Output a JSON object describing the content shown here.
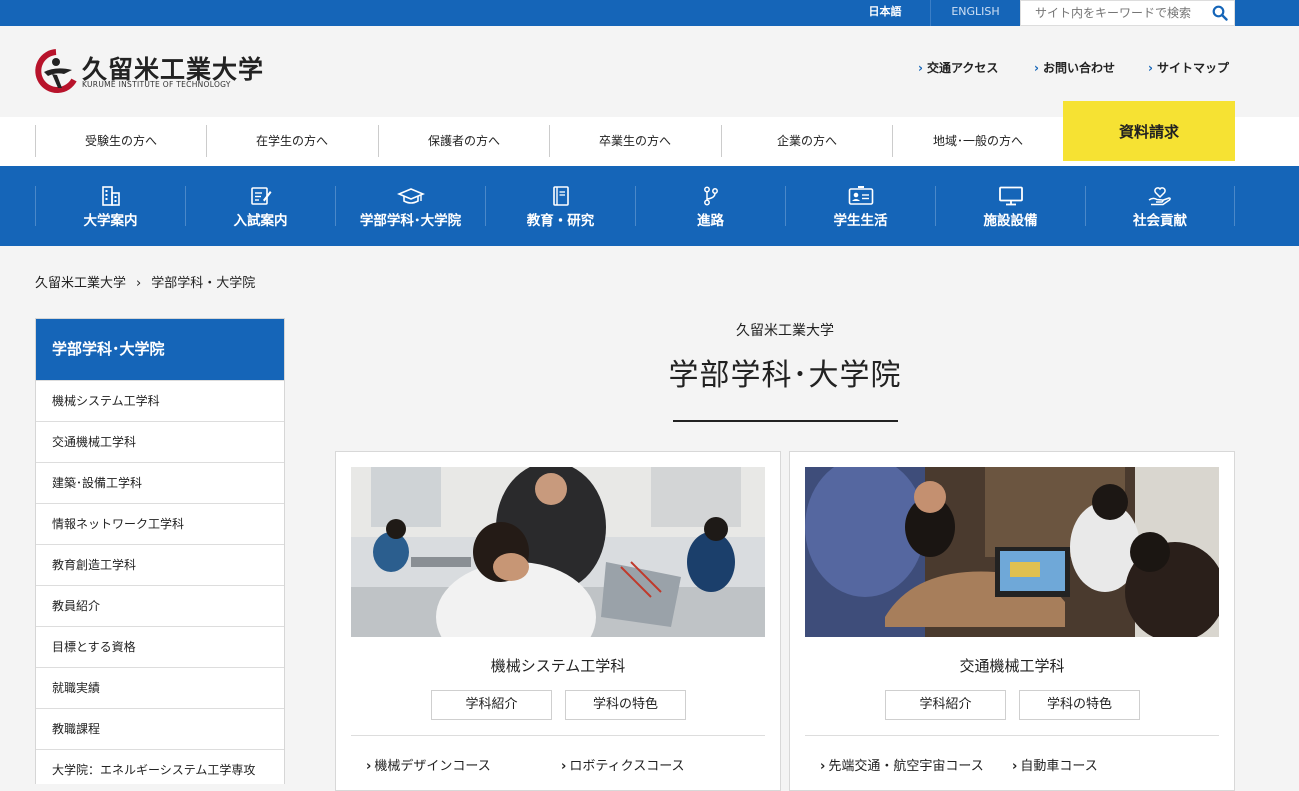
{
  "topbar": {
    "lang_ja": "日本語",
    "lang_en": "ENGLISH",
    "search_placeholder": "サイト内をキーワードで検索",
    "search_icon": "search-icon"
  },
  "header": {
    "logo_name": "久留米工業大学",
    "logo_sub": "KURUME INSTITUTE OF TECHNOLOGY",
    "util_links": [
      "交通アクセス",
      "お問い合わせ",
      "サイトマップ"
    ]
  },
  "audience": {
    "items": [
      "受験生の方へ",
      "在学生の方へ",
      "保護者の方へ",
      "卒業生の方へ",
      "企業の方へ",
      "地域･一般の方へ"
    ],
    "request_label": "資料請求"
  },
  "gnav": {
    "items": [
      {
        "label": "大学案内",
        "icon": "building-icon"
      },
      {
        "label": "入試案内",
        "icon": "document-pen-icon"
      },
      {
        "label": "学部学科･大学院",
        "icon": "mortarboard-icon"
      },
      {
        "label": "教育・研究",
        "icon": "book-icon"
      },
      {
        "label": "進路",
        "icon": "branch-icon"
      },
      {
        "label": "学生生活",
        "icon": "id-card-icon"
      },
      {
        "label": "施設設備",
        "icon": "monitor-icon"
      },
      {
        "label": "社会貢献",
        "icon": "hand-heart-icon"
      }
    ]
  },
  "breadcrumb": {
    "home": "久留米工業大学",
    "separator": "›",
    "current": "学部学科・大学院"
  },
  "sidebar": {
    "title": "学部学科･大学院",
    "items": [
      "機械システム工学科",
      "交通機械工学科",
      "建築･設備工学科",
      "情報ネットワーク工学科",
      "教育創造工学科",
      "教員紹介",
      "目標とする資格",
      "就職実績",
      "教職課程",
      "大学院：エネルギーシステム工学専攻"
    ]
  },
  "main": {
    "subtitle": "久留米工業大学",
    "title": "学部学科･大学院"
  },
  "cards": [
    {
      "title": "機械システム工学科",
      "btn1": "学科紹介",
      "btn2": "学科の特色",
      "courses": [
        "機械デザインコース",
        "ロボティクスコース"
      ]
    },
    {
      "title": "交通機械工学科",
      "btn1": "学科紹介",
      "btn2": "学科の特色",
      "courses": [
        "先端交通・航空宇宙コース",
        "自動車コース"
      ]
    }
  ],
  "colors": {
    "brand_blue": "#1565b8",
    "request_yellow": "#f6e233",
    "logo_red": "#b8132b"
  }
}
